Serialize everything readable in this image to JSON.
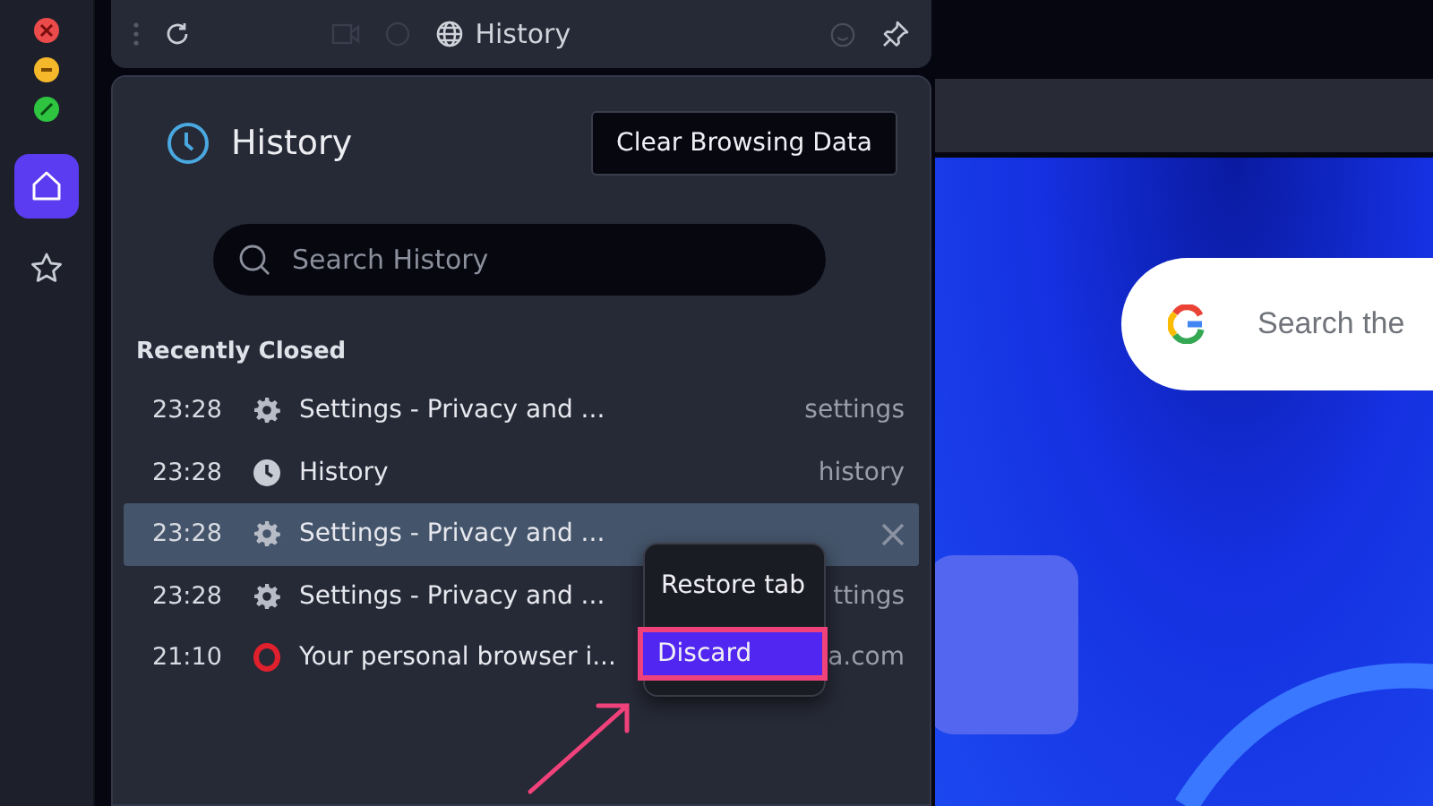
{
  "toolbar": {
    "title": "History"
  },
  "sidebar": {
    "items": [
      {
        "kind": "home",
        "selected": true
      },
      {
        "kind": "star",
        "selected": false
      }
    ]
  },
  "panel": {
    "title": "History",
    "clear_button": "Clear Browsing Data",
    "search": {
      "placeholder": "Search History"
    },
    "section": "Recently Closed",
    "rows": [
      {
        "time": "23:28",
        "kind": "gear",
        "title": "Settings - Privacy and ...",
        "url": "settings",
        "selected": false
      },
      {
        "time": "23:28",
        "kind": "clock",
        "title": "History",
        "url": "history",
        "selected": false
      },
      {
        "time": "23:28",
        "kind": "gear",
        "title": "Settings - Privacy and ...",
        "selected": true
      },
      {
        "time": "23:28",
        "kind": "gear",
        "title": "Settings - Privacy and ...",
        "url": "ttings",
        "selected": false
      },
      {
        "time": "21:10",
        "kind": "opera",
        "title": "Your personal browser i...",
        "url": "a.com",
        "selected": false
      }
    ]
  },
  "context_menu": {
    "items": [
      {
        "label": "Restore tab",
        "selected": false
      },
      {
        "label": "Discard",
        "selected": true
      }
    ]
  },
  "page": {
    "search": {
      "placeholder": "Search the"
    }
  }
}
